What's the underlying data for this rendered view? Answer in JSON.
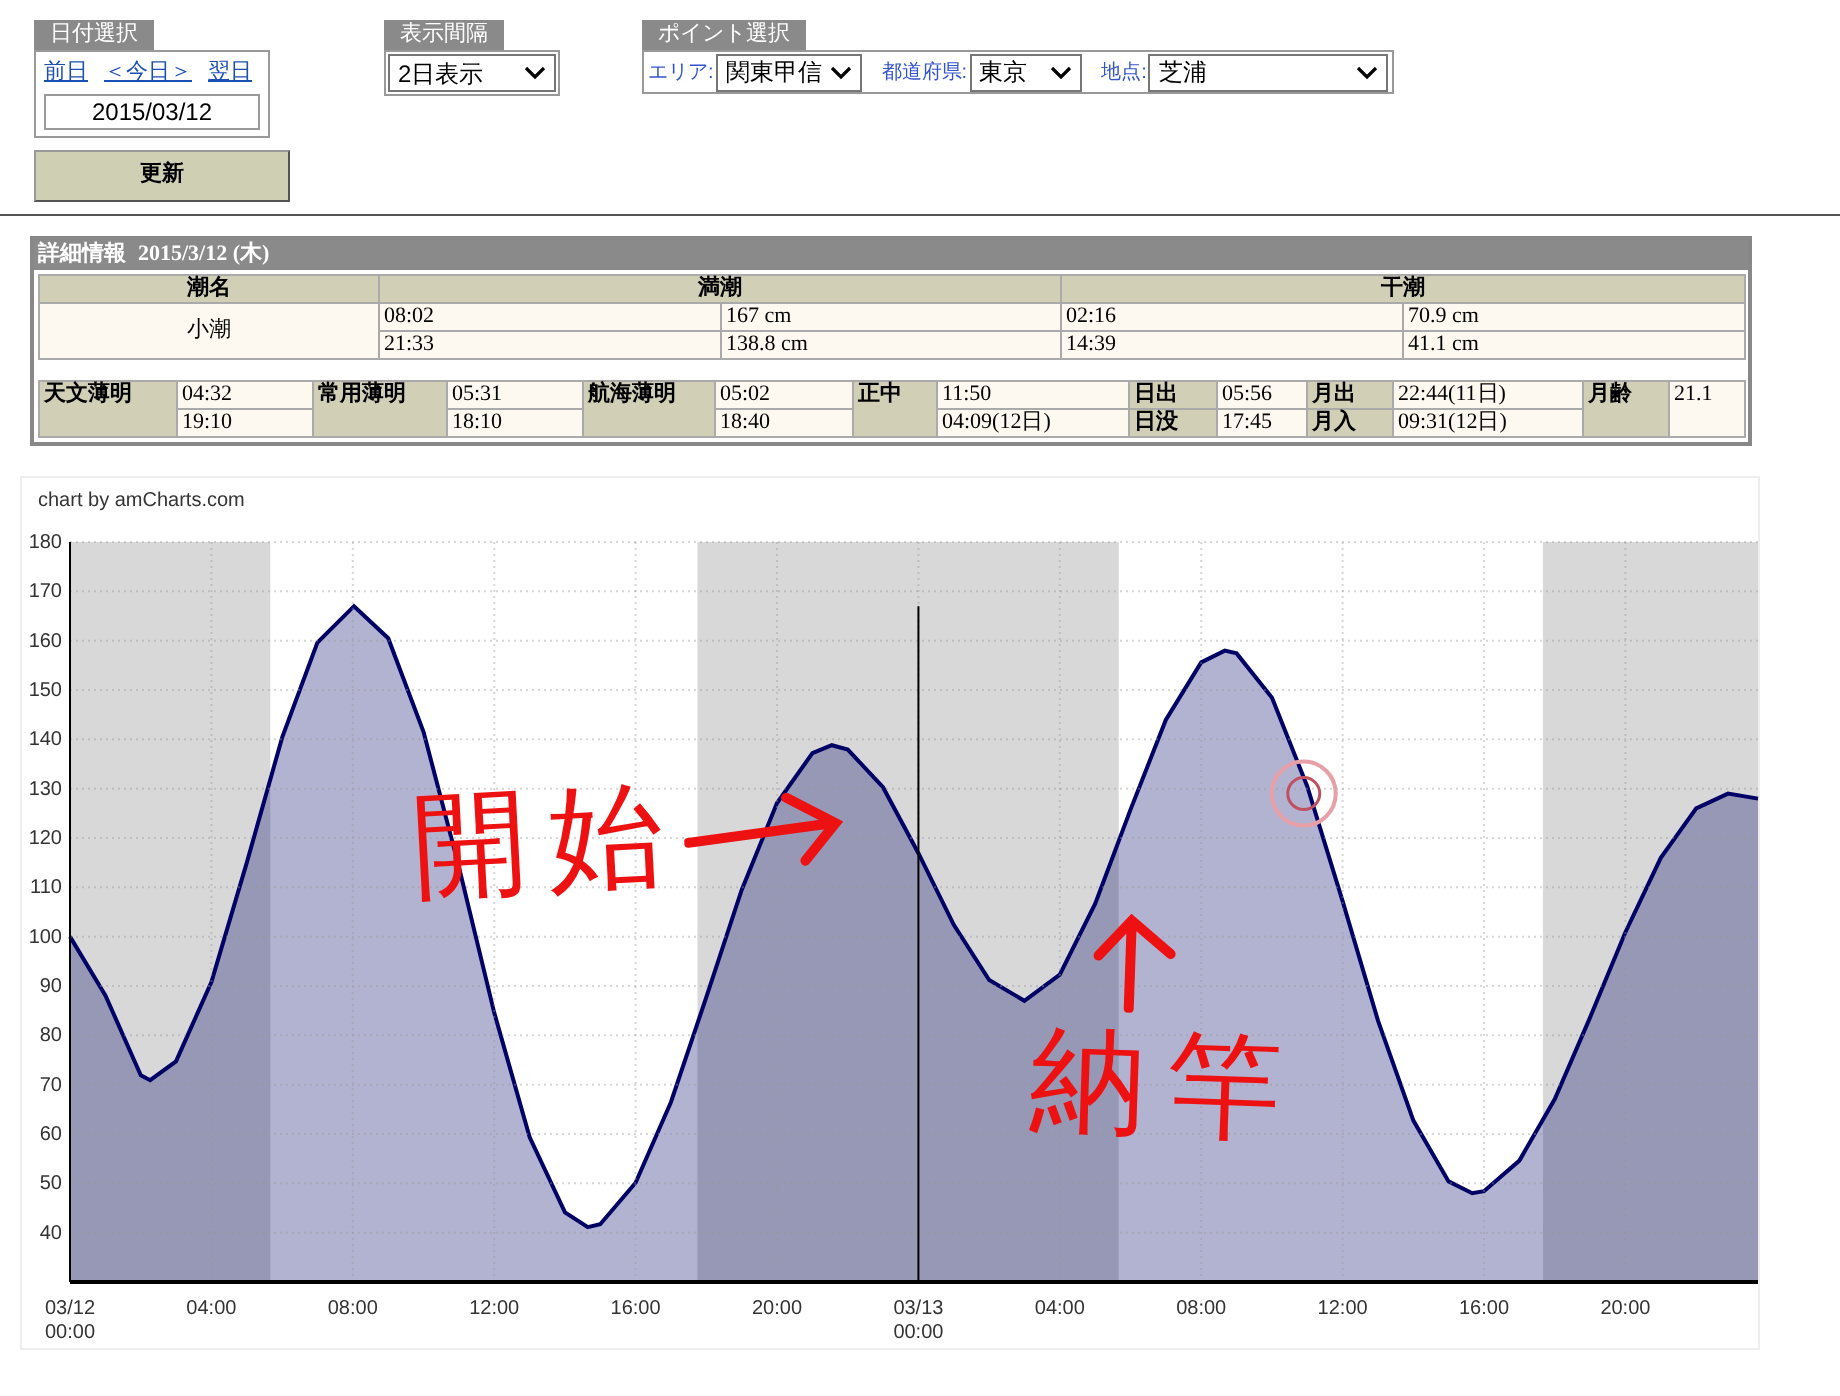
{
  "date_select": {
    "label": "日付選択",
    "links": [
      "前日",
      "＜今日＞",
      "翌日"
    ],
    "date": "2015/03/12"
  },
  "update_button": "更新",
  "interval_select": {
    "label": "表示間隔",
    "value": "2日表示"
  },
  "point_select": {
    "label": "ポイント選択",
    "fields": [
      {
        "label": "エリア:",
        "value": "関東甲信"
      },
      {
        "label": "都道府県:",
        "value": "東京"
      },
      {
        "label": "地点:",
        "value": "芝浦"
      }
    ]
  },
  "details": {
    "title": "詳細情報",
    "date": "2015/3/12 (木)",
    "tide": {
      "headers": [
        "潮名",
        "満潮",
        "干潮"
      ],
      "name": "小潮",
      "rows": [
        [
          "08:02",
          "167 cm",
          "02:16",
          "70.9 cm"
        ],
        [
          "21:33",
          "138.8 cm",
          "14:39",
          "41.1 cm"
        ]
      ]
    },
    "sun_moon": [
      {
        "kind": "stack",
        "label": "天文薄明",
        "values": [
          "04:32",
          "19:10"
        ]
      },
      {
        "kind": "stack",
        "label": "常用薄明",
        "values": [
          "05:31",
          "18:10"
        ]
      },
      {
        "kind": "stack",
        "label": "航海薄明",
        "values": [
          "05:02",
          "18:40"
        ]
      },
      {
        "kind": "stack",
        "label": "正中",
        "values": [
          "11:50",
          "04:09(12日)"
        ]
      },
      {
        "kind": "pair",
        "rows": [
          {
            "label": "日出",
            "value": "05:56"
          },
          {
            "label": "日没",
            "value": "17:45"
          }
        ]
      },
      {
        "kind": "pair",
        "rows": [
          {
            "label": "月出",
            "value": "22:44(11日)"
          },
          {
            "label": "月入",
            "value": "09:31(12日)"
          }
        ]
      },
      {
        "kind": "single",
        "label": "月齢",
        "value": "21.1"
      }
    ]
  },
  "chart": {
    "credit": "chart by amCharts.com",
    "chart_data": {
      "type": "area",
      "x": [
        "2015-03-12T00:00",
        "2015-03-12T01:00",
        "2015-03-12T02:00",
        "2015-03-12T02:16",
        "2015-03-12T03:00",
        "2015-03-12T04:00",
        "2015-03-12T05:00",
        "2015-03-12T06:00",
        "2015-03-12T07:00",
        "2015-03-12T08:02",
        "2015-03-12T09:00",
        "2015-03-12T10:00",
        "2015-03-12T11:00",
        "2015-03-12T12:00",
        "2015-03-12T13:00",
        "2015-03-12T14:00",
        "2015-03-12T14:39",
        "2015-03-12T15:00",
        "2015-03-12T16:00",
        "2015-03-12T17:00",
        "2015-03-12T18:00",
        "2015-03-12T19:00",
        "2015-03-12T20:00",
        "2015-03-12T21:00",
        "2015-03-12T21:33",
        "2015-03-12T22:00",
        "2015-03-12T23:00",
        "2015-03-13T00:00",
        "2015-03-13T01:00",
        "2015-03-13T02:00",
        "2015-03-13T03:00",
        "2015-03-13T04:00",
        "2015-03-13T05:00",
        "2015-03-13T06:00",
        "2015-03-13T07:00",
        "2015-03-13T08:00",
        "2015-03-13T08:40",
        "2015-03-13T09:00",
        "2015-03-13T10:00",
        "2015-03-13T11:00",
        "2015-03-13T12:00",
        "2015-03-13T13:00",
        "2015-03-13T14:00",
        "2015-03-13T15:00",
        "2015-03-13T15:40",
        "2015-03-13T16:00",
        "2015-03-13T17:00",
        "2015-03-13T18:00",
        "2015-03-13T19:00",
        "2015-03-13T20:00",
        "2015-03-13T21:00",
        "2015-03-13T22:00",
        "2015-03-13T22:54",
        "2015-03-13T23:45"
      ],
      "series": [
        {
          "color": "#000066",
          "values": [
            100,
            88.1,
            71.9,
            70.9,
            74.7,
            90.8,
            115.0,
            140.4,
            159.6,
            167,
            160.5,
            141.5,
            114.2,
            84.6,
            59.4,
            44.1,
            41.1,
            41.7,
            50.1,
            66.5,
            87.8,
            109.4,
            127.1,
            137.2,
            138.8,
            137.9,
            130.3,
            116.9,
            102.4,
            91.2,
            87,
            92.3,
            106.7,
            125.8,
            143.9,
            155.6,
            158,
            157.4,
            148.4,
            130.5,
            107.2,
            83.0,
            62.7,
            50.4,
            48,
            48.4,
            54.6,
            67.1,
            83.6,
            100.9,
            116.0,
            126.0,
            129,
            128
          ]
        }
      ],
      "xlim": [
        "2015-03-12T00:00",
        "2015-03-13T23:45"
      ],
      "ylim": [
        30,
        180
      ],
      "xticks": [
        {
          "value": "2015-03-12T00:00",
          "label": "03/12 00:00"
        },
        {
          "value": "2015-03-12T04:00",
          "label": "04:00"
        },
        {
          "value": "2015-03-12T08:00",
          "label": "08:00"
        },
        {
          "value": "2015-03-12T12:00",
          "label": "12:00"
        },
        {
          "value": "2015-03-12T16:00",
          "label": "16:00"
        },
        {
          "value": "2015-03-12T20:00",
          "label": "20:00"
        },
        {
          "value": "2015-03-13T00:00",
          "label": "03/13 00:00"
        },
        {
          "value": "2015-03-13T04:00",
          "label": "04:00"
        },
        {
          "value": "2015-03-13T08:00",
          "label": "08:00"
        },
        {
          "value": "2015-03-13T12:00",
          "label": "12:00"
        },
        {
          "value": "2015-03-13T16:00",
          "label": "16:00"
        },
        {
          "value": "2015-03-13T20:00",
          "label": "20:00"
        }
      ],
      "yticks": [
        40,
        50,
        60,
        70,
        80,
        90,
        100,
        110,
        120,
        130,
        140,
        150,
        160,
        170,
        180
      ],
      "grid": true,
      "bands": [
        {
          "axis": "x",
          "from": "2015-03-12T00:00",
          "to": "2015-03-12T05:40"
        },
        {
          "axis": "x",
          "from": "2015-03-12T17:45",
          "to": "2015-03-13T05:40"
        },
        {
          "axis": "x",
          "from": "2015-03-13T17:40",
          "to": "2015-03-13T23:45"
        }
      ],
      "ref_lines": [
        {
          "axis": "x",
          "value": "2015-03-13T00:00"
        }
      ]
    }
  },
  "handwritten_notes": [
    {
      "text": "開始",
      "kind": "arrow_right"
    },
    {
      "text": "納竿",
      "kind": "arrow_up"
    }
  ]
}
